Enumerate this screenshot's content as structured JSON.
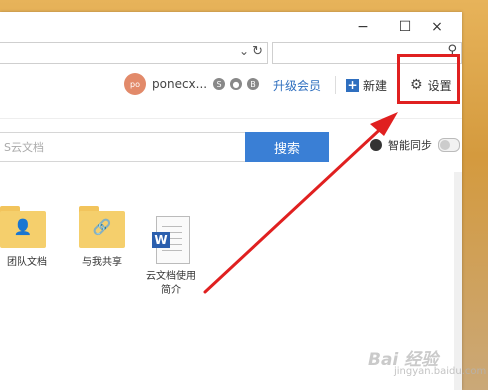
{
  "window": {
    "minimize": "−",
    "maximize": "☐",
    "close": "×"
  },
  "addressbar": {
    "dropdown_icon": "chevron-down-icon",
    "refresh_icon": "refresh-icon"
  },
  "top_search": {
    "icon": "search-icon"
  },
  "toolbar": {
    "avatar_initials": "po",
    "username": "ponecx...",
    "badges": [
      "S",
      "●",
      "B"
    ],
    "upgrade_label": "升级会员",
    "new_label": "新建",
    "settings_label": "设置"
  },
  "doc_search": {
    "placeholder": "S云文档",
    "button_label": "搜索"
  },
  "smart_sync": {
    "label": "智能同步"
  },
  "items": [
    {
      "label": "团队文档"
    },
    {
      "label": "与我共享"
    },
    {
      "label_line1": "云文档使用",
      "label_line2": "简介"
    }
  ],
  "watermark": {
    "brand": "Bai 经验",
    "domain": "jingyan.baidu.com"
  },
  "colors": {
    "accent": "#3a7fd5",
    "annotation": "#e02020",
    "folder": "#f5cf6c"
  }
}
